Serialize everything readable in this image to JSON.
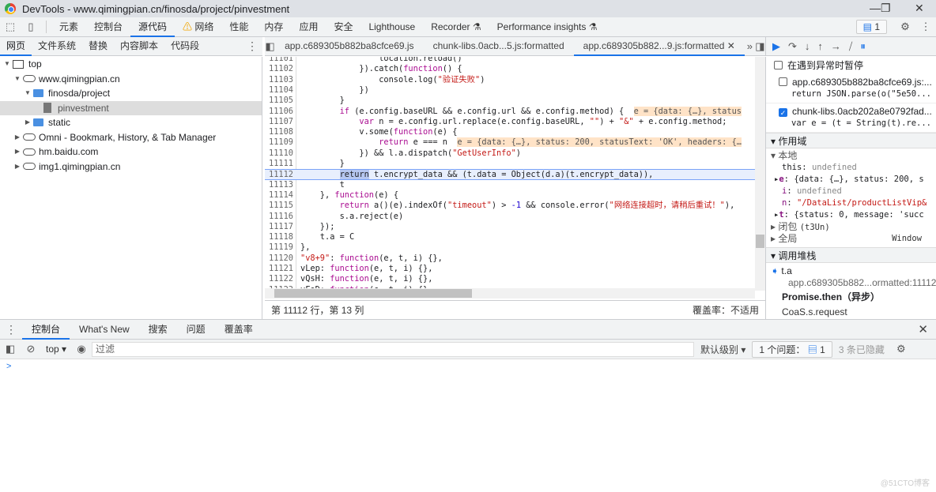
{
  "window": {
    "title": "DevTools - www.qimingpian.cn/finosda/project/pinvestment"
  },
  "toolbar": {
    "tabs": [
      "元素",
      "控制台",
      "源代码",
      "网络",
      "性能",
      "内存",
      "应用",
      "安全",
      "Lighthouse",
      "Recorder",
      "Performance insights"
    ],
    "active": "源代码",
    "issues_count": "1"
  },
  "navigator": {
    "tabs": [
      "网页",
      "文件系统",
      "替换",
      "内容脚本",
      "代码段"
    ],
    "active": "网页",
    "tree": [
      {
        "label": "top",
        "type": "frame",
        "level": 0,
        "expanded": true
      },
      {
        "label": "www.qimingpian.cn",
        "type": "cloud",
        "level": 1,
        "expanded": true
      },
      {
        "label": "finosda/project",
        "type": "folder",
        "level": 2,
        "expanded": true
      },
      {
        "label": "pinvestment",
        "type": "file",
        "level": 3,
        "selected": true
      },
      {
        "label": "static",
        "type": "folder",
        "level": 2,
        "expanded": false
      },
      {
        "label": "Omni - Bookmark, History, & Tab Manager",
        "type": "cloud",
        "level": 1,
        "expanded": false
      },
      {
        "label": "hm.baidu.com",
        "type": "cloud",
        "level": 1,
        "expanded": false
      },
      {
        "label": "img1.qimingpian.cn",
        "type": "cloud",
        "level": 1,
        "expanded": false
      }
    ]
  },
  "editor": {
    "tabs": [
      "app.c689305b882ba8cfce69.js",
      "chunk-libs.0acb...5.js:formatted",
      "app.c689305b882...9.js:formatted"
    ],
    "active_tab": 2,
    "current_line": 11112,
    "lines": [
      {
        "n": "11101",
        "seg": [
          [
            "p",
            "                location.reload()"
          ]
        ]
      },
      {
        "n": "11102",
        "seg": [
          [
            "p",
            "            }).catch("
          ],
          [
            "k",
            "function"
          ],
          [
            "p",
            "() {"
          ]
        ]
      },
      {
        "n": "11103",
        "seg": [
          [
            "p",
            "                console.log("
          ],
          [
            "s",
            "\"验证失败\""
          ],
          [
            "p",
            ")"
          ]
        ]
      },
      {
        "n": "11104",
        "seg": [
          [
            "p",
            "            })"
          ]
        ]
      },
      {
        "n": "11105",
        "seg": [
          [
            "p",
            "        }"
          ]
        ]
      },
      {
        "n": "11106",
        "seg": [
          [
            "p",
            "        "
          ],
          [
            "k",
            "if"
          ],
          [
            "p",
            " (e.config.baseURL && e.config.url && e.config.method) {  "
          ],
          [
            "h",
            "e = {data: {…}, status"
          ]
        ]
      },
      {
        "n": "11107",
        "seg": [
          [
            "p",
            "            "
          ],
          [
            "k",
            "var"
          ],
          [
            "p",
            " n = e.config.url.replace(e.config.baseURL, "
          ],
          [
            "s",
            "\"\""
          ],
          [
            "p",
            ") + "
          ],
          [
            "s",
            "\"&\""
          ],
          [
            "p",
            " + e.config.method;"
          ]
        ]
      },
      {
        "n": "11108",
        "seg": [
          [
            "p",
            "            v.some("
          ],
          [
            "k",
            "function"
          ],
          [
            "p",
            "(e) {"
          ]
        ]
      },
      {
        "n": "11109",
        "seg": [
          [
            "p",
            "                "
          ],
          [
            "k",
            "return"
          ],
          [
            "p",
            " e === n  "
          ],
          [
            "h",
            "e = {data: {…}, status: 200, statusText: 'OK', headers: {…"
          ]
        ]
      },
      {
        "n": "11110",
        "seg": [
          [
            "p",
            "            }) && l.a.dispatch("
          ],
          [
            "s",
            "\"GetUserInfo\""
          ],
          [
            "p",
            ")"
          ]
        ]
      },
      {
        "n": "11111",
        "seg": [
          [
            "p",
            "        }"
          ]
        ]
      },
      {
        "n": "11112",
        "seg": [
          [
            "p",
            "        "
          ],
          [
            "sel",
            "return"
          ],
          [
            "p",
            " t.encrypt_data && (t.data = Object(d.a)(t.encrypt_data)),"
          ]
        ]
      },
      {
        "n": "11113",
        "seg": [
          [
            "p",
            "        t"
          ]
        ]
      },
      {
        "n": "11114",
        "seg": [
          [
            "p",
            "    }, "
          ],
          [
            "k",
            "function"
          ],
          [
            "p",
            "(e) {"
          ]
        ]
      },
      {
        "n": "11115",
        "seg": [
          [
            "p",
            "        "
          ],
          [
            "k",
            "return"
          ],
          [
            "p",
            " a()(e).indexOf("
          ],
          [
            "s",
            "\"timeout\""
          ],
          [
            "p",
            ") > "
          ],
          [
            "n",
            "-1"
          ],
          [
            "p",
            " && console.error("
          ],
          [
            "s",
            "\"网络连接超时，请稍后重试！\""
          ],
          [
            "p",
            "),"
          ]
        ]
      },
      {
        "n": "11116",
        "seg": [
          [
            "p",
            "        s.a.reject(e)"
          ]
        ]
      },
      {
        "n": "11117",
        "seg": [
          [
            "p",
            "    });"
          ]
        ]
      },
      {
        "n": "11118",
        "seg": [
          [
            "p",
            "    t.a = C"
          ]
        ]
      },
      {
        "n": "11119",
        "seg": [
          [
            "p",
            "},"
          ]
        ]
      },
      {
        "n": "11120",
        "seg": [
          [
            "s",
            "\"v8+9\""
          ],
          [
            "p",
            ": "
          ],
          [
            "k",
            "function"
          ],
          [
            "p",
            "(e, t, i) {},"
          ]
        ]
      },
      {
        "n": "11121",
        "seg": [
          [
            "p",
            "vLep: "
          ],
          [
            "k",
            "function"
          ],
          [
            "p",
            "(e, t, i) {},"
          ]
        ]
      },
      {
        "n": "11122",
        "seg": [
          [
            "p",
            "vQsH: "
          ],
          [
            "k",
            "function"
          ],
          [
            "p",
            "(e, t, i) {},"
          ]
        ]
      },
      {
        "n": "11123",
        "seg": [
          [
            "p",
            "vFoD: "
          ],
          [
            "k",
            "function"
          ],
          [
            "p",
            "(e, t, i) {},"
          ]
        ]
      }
    ],
    "status_position": "第 11112 行，第 13 列",
    "coverage": "覆盖率：不适用"
  },
  "debugger": {
    "pause_on_exceptions": "在遇到异常时暂停",
    "breakpoints": [
      {
        "file": "app.c689305b882ba8cfce69.js:...",
        "code": "return JSON.parse(o(\"5e50...",
        "checked": false
      },
      {
        "file": "chunk-libs.0acb202a8e0792fad...",
        "code": "var e = (t = String(t).re...",
        "checked": true
      }
    ],
    "scope_title": "作用域",
    "local_title": "本地",
    "local": [
      {
        "name": "this",
        "value": "undefined",
        "expandable": false
      },
      {
        "name": "e",
        "value": "{data: {…}, status: 200, s",
        "expandable": true
      },
      {
        "name": "i",
        "value": "undefined",
        "expandable": false
      },
      {
        "name": "n",
        "value": "\"/DataList/productListVip&",
        "expandable": false
      },
      {
        "name": "t",
        "value": "{status: 0, message: 'succ",
        "expandable": true
      }
    ],
    "closure": "闭包",
    "closure_name": "(t3Un)",
    "global": "全局",
    "global_value": "Window",
    "callstack_title": "调用堆栈",
    "frames": [
      {
        "name": "t.a",
        "location": "app.c689305b882...ormatted:11112"
      }
    ],
    "async_label": "Promise.then（异步）",
    "next_frame": "CoaS.s.request"
  },
  "drawer": {
    "tabs": [
      "控制台",
      "What's New",
      "搜索",
      "问题",
      "覆盖率"
    ],
    "active": "控制台",
    "context": "top",
    "filter_placeholder": "过滤",
    "levels": "默认级别",
    "issues": "1 个问题：",
    "issues_count": "1",
    "hidden": "3 条已隐藏",
    "prompt": ">"
  },
  "watermark": "@51CTO博客",
  "colors": {
    "accent": "#1a73e8",
    "keyword": "#aa0d91",
    "string": "#c41a16",
    "hint": "#ffe3c7"
  }
}
